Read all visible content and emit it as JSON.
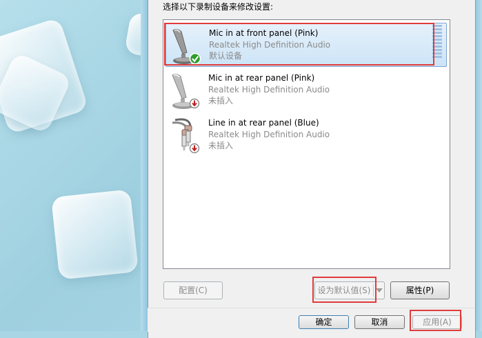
{
  "dialog": {
    "instruction": "选择以下录制设备来修改设置:"
  },
  "devices": [
    {
      "name": "Mic in at front panel (Pink)",
      "driver": "Realtek High Definition Audio",
      "status": "默认设备",
      "icon": "microphone-icon",
      "badge": "green-checkmark-icon",
      "selected": true
    },
    {
      "name": "Mic in at rear panel (Pink)",
      "driver": "Realtek High Definition Audio",
      "status": "未插入",
      "icon": "microphone-icon",
      "badge": "red-down-arrow-icon",
      "selected": false
    },
    {
      "name": "Line in at rear panel (Blue)",
      "driver": "Realtek High Definition Audio",
      "status": "未插入",
      "icon": "rca-cable-icon",
      "badge": "red-down-arrow-icon",
      "selected": false
    }
  ],
  "buttons": {
    "configure": "配置(C)",
    "set_default": "设为默认值(S)",
    "properties": "属性(P)",
    "ok": "确定",
    "cancel": "取消",
    "apply": "应用(A)"
  },
  "colors": {
    "highlight": "#e03a3a",
    "selection": "#cce4f7",
    "wallpaper": "#a9d6e4"
  }
}
